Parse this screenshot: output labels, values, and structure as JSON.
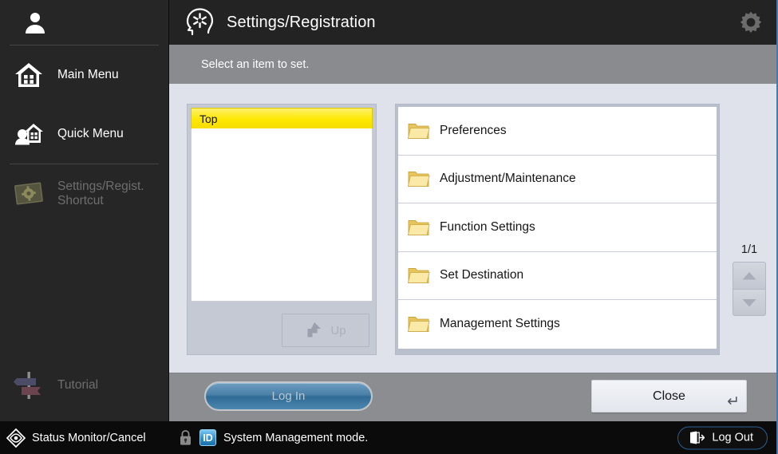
{
  "sidebar": {
    "user_icon": "user-icon",
    "items": [
      {
        "label": "Main Menu",
        "icon": "home-icon",
        "enabled": true
      },
      {
        "label": "Quick Menu",
        "icon": "user-home-icon",
        "enabled": true
      },
      {
        "label": "Settings/Regist.\nShortcut",
        "label_line1": "Settings/Regist.",
        "label_line2": "Shortcut",
        "icon": "settings-card-icon",
        "enabled": false
      }
    ],
    "tutorial": {
      "label": "Tutorial",
      "icon": "signpost-icon"
    },
    "status_monitor": {
      "label": "Status Monitor/Cancel",
      "icon": "eye-diamond-icon"
    }
  },
  "titlebar": {
    "icon": "settings-registration-head-icon",
    "title": "Settings/Registration",
    "gear_icon": "gear-icon"
  },
  "infobar": {
    "text": "Select an item to set."
  },
  "tree_panel": {
    "header": "Top",
    "entries": [],
    "up_button": {
      "label": "Up",
      "icon": "arrow-up-left-icon",
      "enabled": false
    }
  },
  "item_list": {
    "items": [
      {
        "label": "Preferences",
        "icon": "folder-icon"
      },
      {
        "label": "Adjustment/Maintenance",
        "icon": "folder-icon"
      },
      {
        "label": "Function Settings",
        "icon": "folder-icon"
      },
      {
        "label": "Set Destination",
        "icon": "folder-icon"
      },
      {
        "label": "Management Settings",
        "icon": "folder-icon"
      }
    ]
  },
  "pager": {
    "page_indicator": "1/1",
    "up_icon": "triangle-up-icon",
    "down_icon": "triangle-down-icon"
  },
  "buttons": {
    "login": {
      "label": "Log In"
    },
    "close": {
      "label": "Close",
      "enter_glyph": "↵"
    }
  },
  "status_bar": {
    "lock_icon": "lock-icon",
    "id_badge": "ID",
    "message": "System Management mode.",
    "logout": {
      "label": "Log Out",
      "icon": "exit-door-icon"
    }
  },
  "colors": {
    "accent_blue": "#2f7fd0",
    "highlight_yellow": "#ffe800",
    "folder_yellow": "#f2d574",
    "panel_bg": "#dfe2ea",
    "info_gray": "#898b8f",
    "sidebar_dark": "#262626",
    "login_blue": "#4a7fa6"
  }
}
